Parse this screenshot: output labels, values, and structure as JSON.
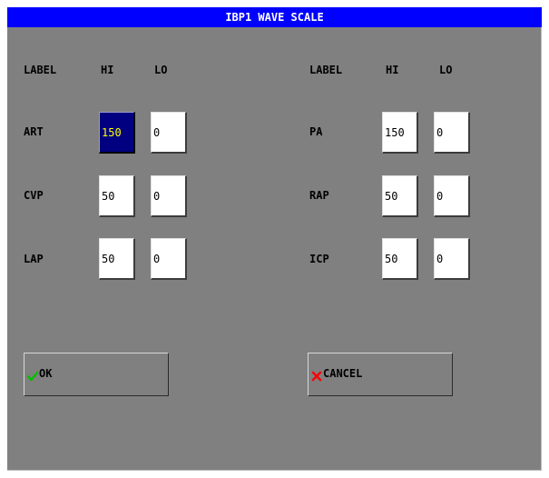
{
  "dialog": {
    "title": "IBP1 WAVE SCALE"
  },
  "headers": {
    "left": {
      "label": "LABEL",
      "hi": "HI",
      "lo": "LO"
    },
    "right": {
      "label": "LABEL",
      "hi": "HI",
      "lo": "LO"
    }
  },
  "left_rows": [
    {
      "label": "ART",
      "hi": "150",
      "lo": "0"
    },
    {
      "label": "CVP",
      "hi": "50",
      "lo": "0"
    },
    {
      "label": "LAP",
      "hi": "50",
      "lo": "0"
    }
  ],
  "right_rows": [
    {
      "label": "PA",
      "hi": "150",
      "lo": "0"
    },
    {
      "label": "RAP",
      "hi": "50",
      "lo": "0"
    },
    {
      "label": "ICP",
      "hi": "50",
      "lo": "0"
    }
  ],
  "selected_field": "left_rows.0.hi",
  "buttons": {
    "ok": {
      "label": "OK",
      "icon": "checkmark-icon",
      "icon_color": "#00c000"
    },
    "cancel": {
      "label": "CANCEL",
      "icon": "cross-icon",
      "icon_color": "#ff0000"
    }
  },
  "colors": {
    "title_bar": "#0000ff",
    "title_text": "#ffffff",
    "dialog_bg": "#808080",
    "selected_field_bg": "#000080",
    "selected_field_text": "#ffff00"
  }
}
